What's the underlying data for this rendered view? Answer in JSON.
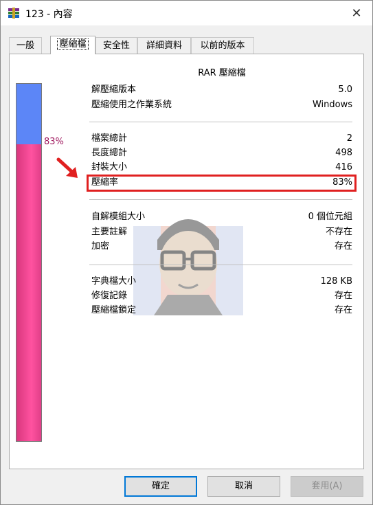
{
  "window": {
    "title": "123 - 內容",
    "close_icon": "close-icon"
  },
  "tabs": [
    {
      "label": "一般"
    },
    {
      "label": "壓縮檔"
    },
    {
      "label": "安全性"
    },
    {
      "label": "詳細資料"
    },
    {
      "label": "以前的版本"
    }
  ],
  "active_tab": "壓縮檔",
  "archive": {
    "heading": "RAR 壓縮檔",
    "ratio_percent_label": "83%",
    "ratio_fraction": 0.83,
    "colors": {
      "used": "#ff4fa0",
      "free": "#5c86f7",
      "highlight": "#e02020",
      "percent_text": "#a0195f"
    },
    "group1": [
      {
        "label": "解壓縮版本",
        "value": "5.0"
      },
      {
        "label": "壓縮使用之作業系統",
        "value": "Windows"
      }
    ],
    "group2": [
      {
        "label": "檔案總計",
        "value": "2"
      },
      {
        "label": "長度總計",
        "value": "498"
      },
      {
        "label": "封裝大小",
        "value": "416"
      },
      {
        "label": "壓縮率",
        "value": "83%"
      }
    ],
    "group3": [
      {
        "label": "自解模組大小",
        "value": "0 個位元組"
      },
      {
        "label": "主要註解",
        "value": "不存在"
      },
      {
        "label": "加密",
        "value": "存在"
      }
    ],
    "group4": [
      {
        "label": "字典檔大小",
        "value": "128 KB"
      },
      {
        "label": "修復記錄",
        "value": "存在"
      },
      {
        "label": "壓縮檔鎖定",
        "value": "存在"
      }
    ]
  },
  "buttons": {
    "ok": "確定",
    "cancel": "取消",
    "apply": "套用(A)"
  }
}
